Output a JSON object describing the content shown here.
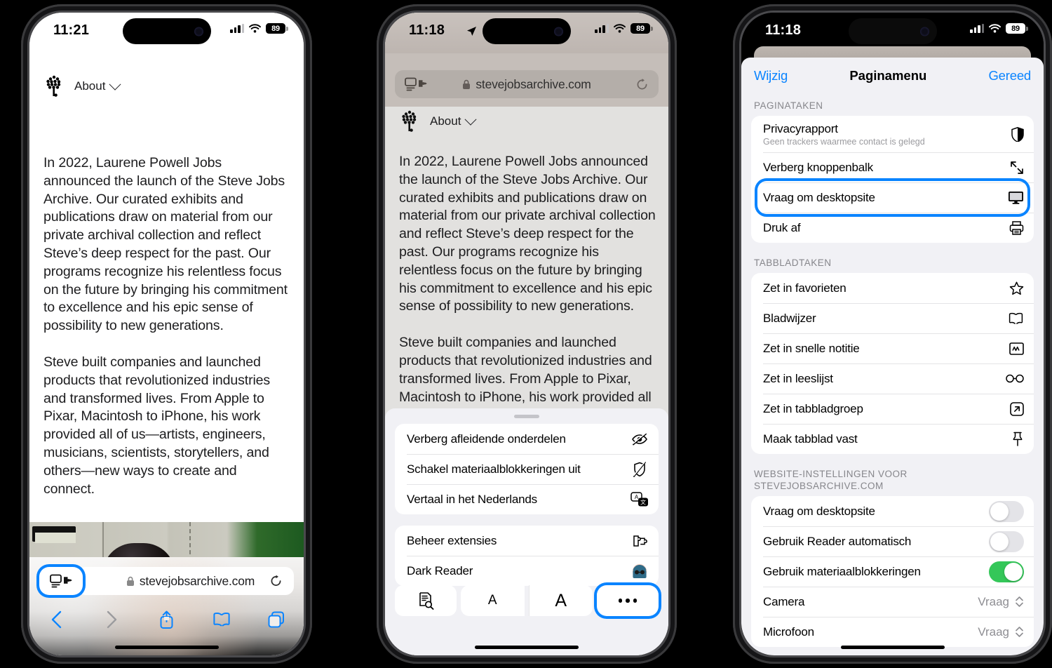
{
  "phone1": {
    "status": {
      "time": "11:21",
      "battery": "89",
      "wifi_icon": "wifi-icon",
      "signal_icon": "cellular-icon"
    },
    "site": {
      "nav_label": "About",
      "logo_icon": "steve-jobs-archive-logo"
    },
    "paragraphs": [
      "In 2022, Laurene Powell Jobs announced the launch of the Steve Jobs Archive. Our curated exhibits and publications draw on material from our private archival collection and reflect Steve’s deep respect for the past. Our programs recognize his relentless focus on the future by bringing his commitment to excellence and his epic sense of possibility to new generations.",
      "Steve built companies and launched products that revolutionized industries and transformed lives. From Apple to Pixar, Macintosh to iPhone, his work provided all of us—artists, engineers, musicians, scientists, storytellers, and others—new ways to create and connect."
    ],
    "toolbar": {
      "format_button_name": "page-settings-button",
      "url": "stevejobsarchive.com",
      "lock_icon": "lock-icon",
      "reload_icon": "reload-icon",
      "back_icon": "back-chevron-icon",
      "forward_icon": "forward-chevron-icon",
      "share_icon": "share-icon",
      "bookmarks_icon": "book-icon",
      "tabs_icon": "tabs-icon"
    },
    "accent": "#0a84ff"
  },
  "phone2": {
    "status": {
      "time": "11:18",
      "battery": "89",
      "location_icon": "location-arrow-icon"
    },
    "url": "stevejobsarchive.com",
    "site": {
      "nav_label": "About"
    },
    "paragraphs": [
      "In 2022, Laurene Powell Jobs announced the launch of the Steve Jobs Archive. Our curated exhibits and publications draw on material from our private archival collection and reflect Steve’s deep respect for the past. Our programs recognize his relentless focus on the future by bringing his commitment to excellence and his epic sense of possibility to new generations.",
      "Steve built companies and launched products that revolutionized industries and transformed lives. From Apple to Pixar, Macintosh to iPhone, his work provided all of us—artists, engineers, musicians, scientists, storytellers, and others—"
    ],
    "menu_group_1": [
      {
        "label": "Verberg afleidende onderdelen",
        "icon": "eye-slash-icon"
      },
      {
        "label": "Schakel materiaalblokkeringen uit",
        "icon": "shield-slash-icon"
      },
      {
        "label": "Vertaal in het Nederlands",
        "icon": "translate-icon"
      }
    ],
    "menu_group_2": [
      {
        "label": "Beheer extensies",
        "icon": "puzzle-piece-icon"
      },
      {
        "label": "Dark Reader",
        "icon": "dark-reader-extension-icon"
      }
    ],
    "tools": [
      {
        "name": "find-on-page-button",
        "label": ""
      },
      {
        "name": "decrease-text-size-button",
        "label": "A"
      },
      {
        "name": "increase-text-size-button",
        "label": "A"
      },
      {
        "name": "more-button",
        "label": "…"
      }
    ]
  },
  "phone3": {
    "status": {
      "time": "11:18",
      "battery": "89"
    },
    "header": {
      "edit": "Wijzig",
      "title": "Paginamenu",
      "done": "Gereed"
    },
    "sections": [
      {
        "title": "PAGINATAKEN",
        "rows": [
          {
            "label": "Privacyrapport",
            "sub": "Geen trackers waarmee contact is gelegd",
            "icon": "privacy-shield-icon",
            "type": "action"
          },
          {
            "label": "Verberg knoppenbalk",
            "icon": "expand-arrows-icon",
            "type": "action"
          },
          {
            "label": "Vraag om desktopsite",
            "icon": "desktop-monitor-icon",
            "type": "action",
            "highlighted": true
          },
          {
            "label": "Druk af",
            "icon": "printer-icon",
            "type": "action"
          }
        ]
      },
      {
        "title": "TABBLADTAKEN",
        "rows": [
          {
            "label": "Zet in favorieten",
            "icon": "star-icon",
            "type": "action"
          },
          {
            "label": "Bladwijzer",
            "icon": "book-icon",
            "type": "action"
          },
          {
            "label": "Zet in snelle notitie",
            "icon": "quick-note-icon",
            "type": "action"
          },
          {
            "label": "Zet in leeslijst",
            "icon": "glasses-icon",
            "type": "action"
          },
          {
            "label": "Zet in tabbladgroep",
            "icon": "arrow-box-icon",
            "type": "action"
          },
          {
            "label": "Maak tabblad vast",
            "icon": "pin-icon",
            "type": "action"
          }
        ]
      },
      {
        "title": "WEBSITE-INSTELLINGEN VOOR STEVEJOBSARCHIVE.COM",
        "rows": [
          {
            "label": "Vraag om desktopsite",
            "type": "toggle",
            "on": false
          },
          {
            "label": "Gebruik Reader automatisch",
            "type": "toggle",
            "on": false
          },
          {
            "label": "Gebruik materiaalblokkeringen",
            "type": "toggle",
            "on": true
          },
          {
            "label": "Camera",
            "type": "select",
            "value": "Vraag"
          },
          {
            "label": "Microfoon",
            "type": "select",
            "value": "Vraag"
          }
        ]
      }
    ],
    "accent": "#0a84ff",
    "toggle_on_color": "#34c759"
  }
}
